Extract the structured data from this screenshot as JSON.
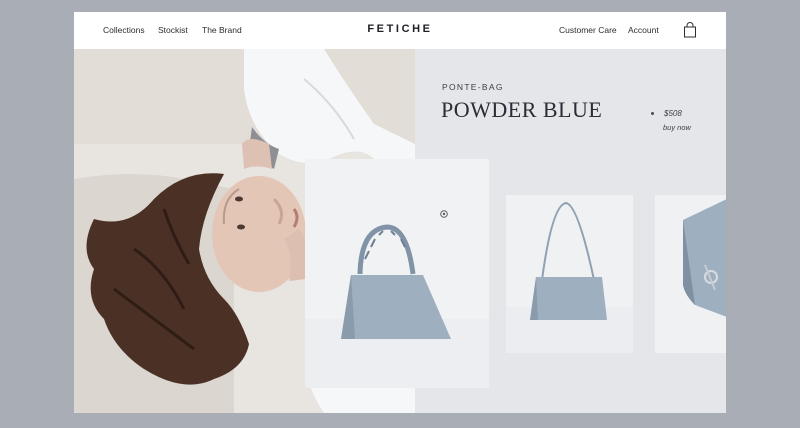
{
  "nav": {
    "left_links": [
      "Collections",
      "Stockist",
      "The Brand"
    ],
    "brand": "FETICHE",
    "right_links": [
      "Customer Care",
      "Account"
    ],
    "bag_icon": "shopping-bag-icon"
  },
  "product": {
    "subtitle": "PONTE-BAG",
    "title": "POWDER BLUE",
    "price": "$508",
    "buy_label": "buy now"
  },
  "colors": {
    "page_bg": "#a9adb6",
    "panel_bg": "#e4e6ea",
    "bag": "#9eafc0",
    "text": "#2a2d35"
  },
  "icons": {
    "zoom": "zoom-icon"
  }
}
